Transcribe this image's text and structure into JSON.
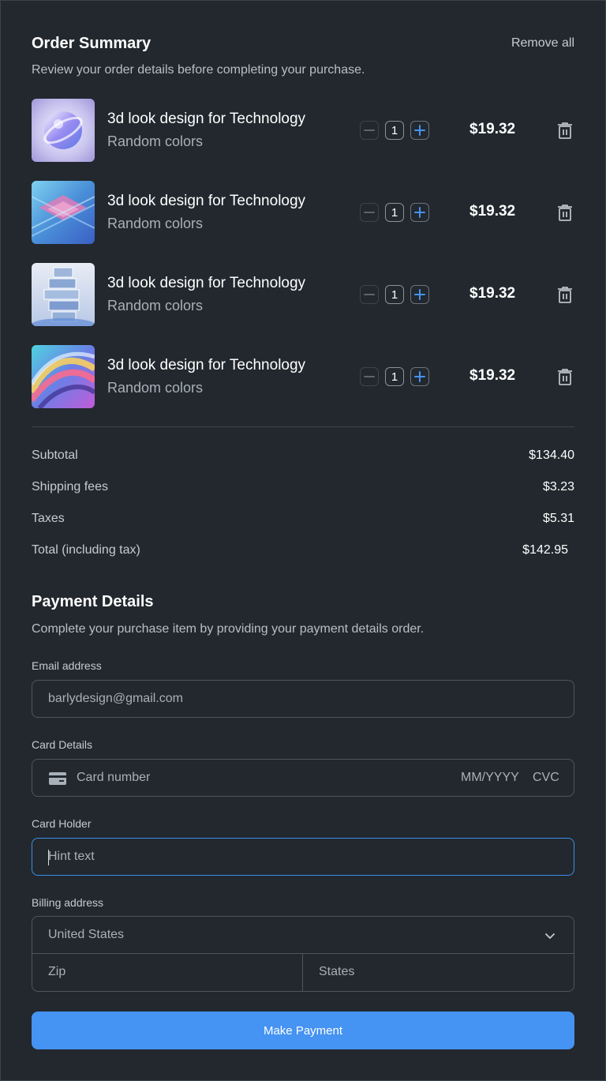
{
  "order": {
    "title": "Order Summary",
    "remove_all": "Remove all",
    "subtitle": "Review your order details before completing your purchase.",
    "items": [
      {
        "name": "3d look design for Technology",
        "variant": "Random colors",
        "qty": "1",
        "price": "$19.32"
      },
      {
        "name": "3d look design for Technology",
        "variant": "Random colors",
        "qty": "1",
        "price": "$19.32"
      },
      {
        "name": "3d look design for Technology",
        "variant": "Random colors",
        "qty": "1",
        "price": "$19.32"
      },
      {
        "name": "3d look design for Technology",
        "variant": "Random colors",
        "qty": "1",
        "price": "$19.32"
      }
    ]
  },
  "summary": {
    "subtotal_label": "Subtotal",
    "subtotal": "$134.40",
    "shipping_label": "Shipping fees",
    "shipping": "$3.23",
    "taxes_label": "Taxes",
    "taxes": "$5.31",
    "total_label": "Total (including tax)",
    "total": "$142.95"
  },
  "payment": {
    "title": "Payment Details",
    "subtitle": "Complete your purchase item by providing your payment details order.",
    "email_label": "Email address",
    "email_value": "barlydesign@gmail.com",
    "card_label": "Card Details",
    "card_number_placeholder": "Card number",
    "card_exp_placeholder": "MM/YYYY",
    "card_cvc_placeholder": "CVC",
    "holder_label": "Card Holder",
    "holder_placeholder": "Hint text",
    "billing_label": "Billing address",
    "country_value": "United States",
    "zip_placeholder": "Zip",
    "state_placeholder": "States",
    "submit_label": "Make Payment"
  },
  "colors": {
    "background": "#22282e",
    "accent": "#4593f2",
    "focus_border": "#3d8fe6"
  },
  "icons": {
    "qty_minus": "minus-icon",
    "qty_plus": "plus-icon",
    "delete": "trash-icon",
    "card": "credit-card-icon",
    "select": "chevron-down-icon"
  }
}
